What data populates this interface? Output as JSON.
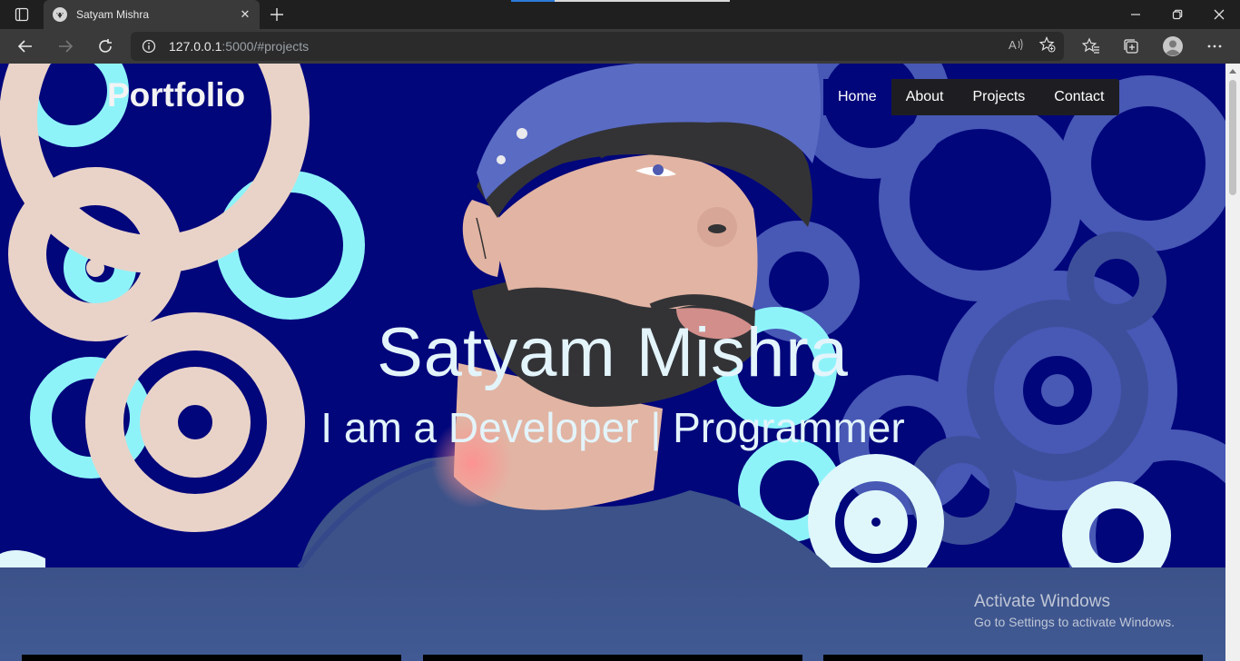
{
  "browser": {
    "tab_title": "Satyam Mishra",
    "tab_close_glyph": "✕",
    "url_host": "127.0.0.1",
    "url_rest": ":5000/#projects",
    "icons": [
      "tab-actions-icon",
      "site-favicon",
      "close-icon",
      "new-tab-icon",
      "minimize-icon",
      "restore-icon",
      "window-close-icon",
      "back-icon",
      "forward-icon",
      "refresh-icon",
      "site-info-icon",
      "read-aloud-icon",
      "add-favorite-icon",
      "favorites-icon",
      "collections-icon",
      "profile-icon",
      "more-icon"
    ]
  },
  "page": {
    "brand": "Portfolio",
    "nav": [
      {
        "label": "Home",
        "active": true
      },
      {
        "label": "About",
        "active": false
      },
      {
        "label": "Projects",
        "active": false
      },
      {
        "label": "Contact",
        "active": false
      }
    ],
    "hero_name": "Satyam Mishra",
    "hero_tagline": "I am a Developer | Programmer",
    "colors": {
      "hero_bg": "#02067b",
      "section_bg": "#3c5289",
      "nav_bg": "#1e1e22",
      "swirl_peach": "#e9d3c8",
      "swirl_cyan": "#8ef3f9",
      "swirl_blue": "#4758b5"
    }
  },
  "os_watermark": {
    "line1": "Activate Windows",
    "line2": "Go to Settings to activate Windows."
  }
}
